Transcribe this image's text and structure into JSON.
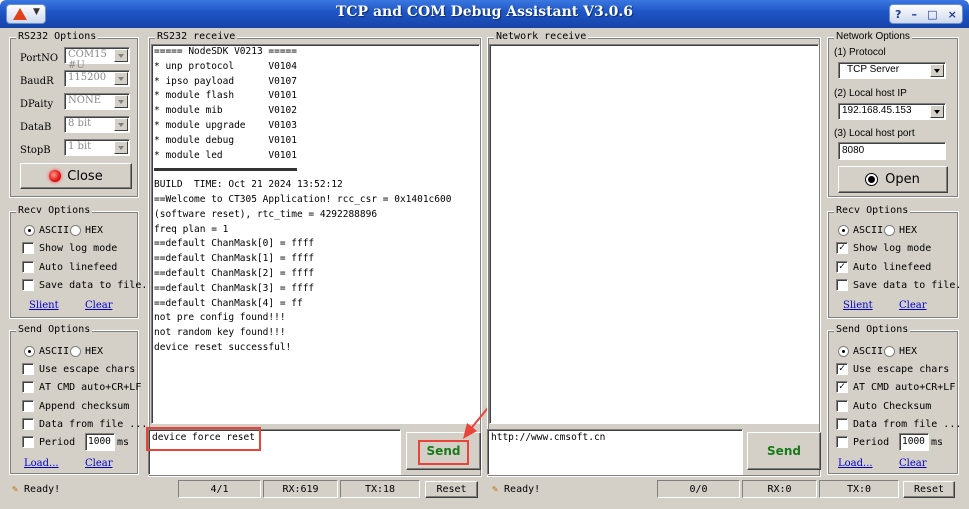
{
  "window": {
    "title": "TCP and COM Debug Assistant  V3.0.6",
    "controls": [
      "?",
      "–",
      "□",
      "×"
    ]
  },
  "left": {
    "rs232_options": {
      "title": "RS232 Options",
      "fields": [
        {
          "label": "PortNO",
          "value": "COM15 #U"
        },
        {
          "label": "BaudR",
          "value": "115200"
        },
        {
          "label": "DPaity",
          "value": "NONE"
        },
        {
          "label": "DataB",
          "value": "8 bit"
        },
        {
          "label": "StopB",
          "value": "1 bit"
        }
      ],
      "close_button": "Close"
    },
    "recv_options": {
      "title": "Recv Options",
      "ascii": "ASCII",
      "hex": "HEX",
      "show_log": "Show log mode",
      "auto_linefeed": "Auto linefeed",
      "save_file": "Save data to file.",
      "silent": "Slient",
      "clear": "Clear"
    },
    "send_options": {
      "title": "Send Options",
      "ascii": "ASCII",
      "hex": "HEX",
      "escape": "Use escape chars",
      "at_cmd": "AT CMD auto+CR+LF",
      "checksum": "Append checksum",
      "data_file": "Data from file ...",
      "period": "Period",
      "period_value": "1000",
      "period_unit": "ms",
      "load": "Load...",
      "clear": "Clear"
    }
  },
  "rs232_receive": {
    "title": "RS232 receive",
    "lines": [
      "===== NodeSDK V0213 =====",
      "* unp protocol      V0104",
      "* ipso payload      V0107",
      "* module flash      V0101",
      "* module mib        V0102",
      "* module upgrade    V0103",
      "* module debug      V0101",
      "* module led        V0101",
      "",
      "BUILD  TIME: Oct 21 2024 13:52:12",
      "==Welcome to CT305 Application! rcc_csr = 0x1401c600",
      "(software reset), rtc_time = 4292288896",
      "freq plan = 1",
      "==default ChanMask[0] = ffff",
      "==default ChanMask[1] = ffff",
      "==default ChanMask[2] = ffff",
      "==default ChanMask[3] = ffff",
      "==default ChanMask[4] = ff",
      "not pre config found!!!",
      "not random key found!!!",
      "device reset successful!"
    ],
    "send_text": "device force reset",
    "send_button": "Send"
  },
  "network_receive": {
    "title": "Network receive",
    "send_text": "http://www.cmsoft.cn",
    "send_button": "Send"
  },
  "right": {
    "network_options": {
      "title": "Network Options",
      "protocol_label": "(1) Protocol",
      "protocol_value": "TCP Server",
      "ip_label": "(2) Local host IP",
      "ip_value": "192.168.45.153",
      "port_label": "(3) Local host port",
      "port_value": "8080",
      "open_button": "Open"
    },
    "recv_options": {
      "title": "Recv Options",
      "ascii": "ASCII",
      "hex": "HEX",
      "show_log": "Show log mode",
      "auto_linefeed": "Auto linefeed",
      "save_file": "Save data to file.",
      "silent": "Slient",
      "clear": "Clear"
    },
    "send_options": {
      "title": "Send Options",
      "ascii": "ASCII",
      "hex": "HEX",
      "escape": "Use escape chars",
      "at_cmd": "AT CMD auto+CR+LF",
      "checksum": "Auto Checksum",
      "data_file": "Data from file ...",
      "period": "Period",
      "period_value": "1000",
      "period_unit": "ms",
      "load": "Load...",
      "clear": "Clear"
    }
  },
  "statusbar": {
    "left_ready": "Ready!",
    "left_count": "4/1",
    "left_rx": "RX:619",
    "left_tx": "TX:18",
    "left_reset": "Reset",
    "right_ready": "Ready!",
    "right_count": "0/0",
    "right_rx": "RX:0",
    "right_tx": "TX:0",
    "right_reset": "Reset"
  },
  "colors": {
    "title_bar": "#1e54c4",
    "annotation": "#e8443a",
    "send_green": "#1a7a1a",
    "link": "#0000cc"
  }
}
